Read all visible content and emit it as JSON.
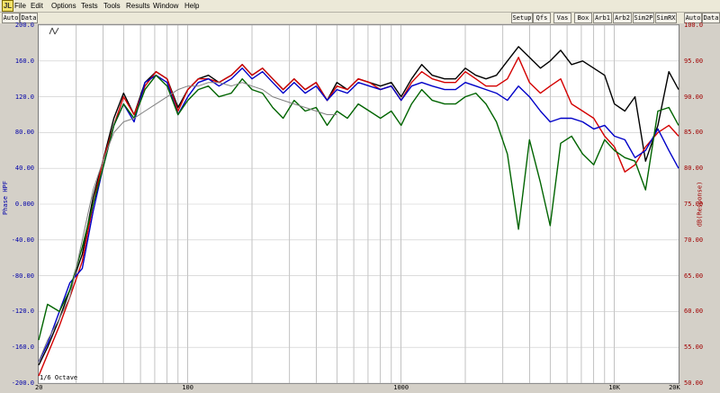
{
  "menu": {
    "app_icon": "JL",
    "items": [
      "File",
      "Edit",
      "Options",
      "Tests",
      "Tools",
      "Results",
      "Window",
      "Help"
    ]
  },
  "toolbar": {
    "left_buttons": [
      "Auto",
      "Data"
    ],
    "right_buttons": [
      "Setup",
      "Qfs",
      "Vas",
      "Box",
      "Arb1",
      "Arb2",
      "Sim2P",
      "SimRX"
    ],
    "far_right": [
      "Auto",
      "Data"
    ]
  },
  "annotation": {
    "smoothing": "1/6 Octave",
    "logo": "JL"
  },
  "colors": {
    "black": "#000000",
    "red": "#d40000",
    "blue": "#0000c8",
    "green": "#006400",
    "gray": "#808080",
    "left_axis": "#0000a8",
    "right_axis": "#a00000"
  },
  "chart_data": {
    "type": "line",
    "x_scale": "log",
    "xlim": [
      20,
      20000
    ],
    "x_tick_labels": [
      "20",
      "100",
      "1000",
      "10K",
      "20K"
    ],
    "x_ticks": [
      20,
      100,
      1000,
      10000,
      20000
    ],
    "left_axis": {
      "label": "Phase HPF",
      "ylim": [
        -200,
        200
      ],
      "ticks": [
        "200.0",
        "160.0",
        "120.0",
        "80.00",
        "40.00",
        "0.000",
        "-40.00",
        "-80.00",
        "-120.0",
        "-160.0",
        "-200.0"
      ]
    },
    "right_axis": {
      "label": "dB(Response)",
      "ylim": [
        50,
        100
      ],
      "ticks": [
        "100.0",
        "95.00",
        "90.00",
        "85.00",
        "80.00",
        "75.00",
        "70.00",
        "65.00",
        "60.00",
        "55.00",
        "50.00"
      ]
    },
    "grid": true,
    "series": [
      {
        "color": "black",
        "x": [
          20,
          22,
          25,
          28,
          32,
          36,
          40,
          45,
          50,
          56,
          63,
          71,
          80,
          90,
          100,
          112,
          125,
          140,
          160,
          180,
          200,
          224,
          250,
          280,
          315,
          355,
          400,
          450,
          500,
          560,
          630,
          710,
          800,
          900,
          1000,
          1120,
          1250,
          1400,
          1600,
          1800,
          2000,
          2240,
          2500,
          2800,
          3150,
          3550,
          4000,
          4500,
          5000,
          5600,
          6300,
          7100,
          8000,
          9000,
          10000,
          11200,
          12500,
          14000,
          16000,
          18000,
          20000
        ],
        "y": [
          52.5,
          55,
          59,
          63,
          68,
          76,
          81,
          87,
          90.5,
          87.5,
          92,
          93.5,
          92.5,
          88.5,
          91,
          92.5,
          93,
          92,
          93,
          94.5,
          93,
          94,
          92.5,
          91,
          92.5,
          91,
          92,
          89.5,
          92,
          91,
          92.5,
          92,
          91.5,
          92,
          90,
          92.5,
          94.5,
          93,
          92.5,
          92.5,
          94,
          93,
          92.5,
          93,
          95,
          97,
          95.5,
          94,
          95,
          96.5,
          94.5,
          95,
          94,
          93,
          89,
          88,
          90,
          81,
          86,
          93.5,
          91
        ]
      },
      {
        "color": "red",
        "x": [
          20,
          22,
          25,
          28,
          32,
          36,
          40,
          45,
          50,
          56,
          63,
          71,
          80,
          90,
          100,
          112,
          125,
          140,
          160,
          180,
          200,
          224,
          250,
          280,
          315,
          355,
          400,
          450,
          500,
          560,
          630,
          710,
          800,
          900,
          1000,
          1120,
          1250,
          1400,
          1600,
          1800,
          2000,
          2240,
          2500,
          2800,
          3150,
          3550,
          4000,
          4500,
          5000,
          5600,
          6300,
          7100,
          8000,
          9000,
          10000,
          11200,
          12500,
          14000,
          16000,
          18000,
          20000
        ],
        "y": [
          51,
          54,
          58,
          62,
          67,
          75,
          81,
          86,
          90,
          87.5,
          91.5,
          93.5,
          92.5,
          88,
          91,
          92.5,
          92.5,
          92,
          93,
          94.5,
          93,
          94,
          92.5,
          91,
          92.5,
          91,
          92,
          89.5,
          91.5,
          91,
          92.5,
          92,
          91,
          91.5,
          89.5,
          92,
          93.5,
          92.5,
          92,
          92,
          93.5,
          92.5,
          91.5,
          91.5,
          92.5,
          95.5,
          92,
          90.5,
          91.5,
          92.5,
          89,
          88,
          87,
          84.5,
          83,
          79.5,
          80.5,
          83,
          85,
          86,
          84.5
        ]
      },
      {
        "color": "blue",
        "x": [
          20,
          22,
          25,
          28,
          32,
          36,
          40,
          45,
          50,
          56,
          63,
          71,
          80,
          90,
          100,
          112,
          125,
          140,
          160,
          180,
          200,
          224,
          250,
          280,
          315,
          355,
          400,
          450,
          500,
          560,
          630,
          710,
          800,
          900,
          1000,
          1120,
          1250,
          1400,
          1600,
          1800,
          2000,
          2240,
          2500,
          2800,
          3150,
          3550,
          4000,
          4500,
          5000,
          5600,
          6300,
          7100,
          8000,
          9000,
          10000,
          11200,
          12500,
          14000,
          16000,
          18000,
          20000
        ],
        "y": [
          53,
          55.5,
          60,
          64,
          66,
          74,
          80,
          86,
          89,
          86.5,
          92,
          93,
          92,
          87.5,
          90,
          92,
          92.5,
          91.5,
          92.5,
          94,
          92.5,
          93.5,
          92,
          90.5,
          92,
          90.5,
          91.5,
          89.5,
          91,
          90.5,
          92,
          91.5,
          91,
          91.5,
          89.5,
          91.5,
          92,
          91.5,
          91,
          91,
          92,
          91.5,
          91,
          90.5,
          89.5,
          91.5,
          90,
          88,
          86.5,
          87,
          87,
          86.5,
          85.5,
          86,
          84.5,
          84,
          81.5,
          82.5,
          85.5,
          82.5,
          80
        ]
      },
      {
        "color": "green",
        "x": [
          20,
          22,
          25,
          28,
          32,
          36,
          40,
          45,
          50,
          56,
          63,
          71,
          80,
          90,
          100,
          112,
          125,
          140,
          160,
          180,
          200,
          224,
          250,
          280,
          315,
          355,
          400,
          450,
          500,
          560,
          630,
          710,
          800,
          900,
          1000,
          1120,
          1250,
          1400,
          1600,
          1800,
          2000,
          2240,
          2500,
          2800,
          3150,
          3550,
          4000,
          4500,
          5000,
          5600,
          6300,
          7100,
          8000,
          9000,
          10000,
          11200,
          12500,
          14000,
          16000,
          18000,
          20000
        ],
        "y": [
          56,
          61,
          60,
          63,
          69,
          75,
          80,
          86,
          89,
          87,
          91,
          93,
          91.5,
          87.5,
          89.5,
          91,
          91.5,
          90,
          90.5,
          92.5,
          91,
          90.5,
          88.5,
          87,
          89.5,
          88,
          88.5,
          86,
          88,
          87,
          89,
          88,
          87,
          88,
          86,
          89,
          91,
          89.5,
          89,
          89,
          90,
          90.5,
          89,
          86.5,
          82,
          71.5,
          84,
          78,
          72,
          83.5,
          84.5,
          82,
          80.5,
          84,
          82.5,
          81.5,
          81,
          77,
          88,
          88.5,
          86
        ]
      },
      {
        "color": "gray",
        "x": [
          20,
          22,
          25,
          28,
          32,
          36,
          40,
          45,
          50,
          56,
          63,
          71,
          80,
          90,
          100,
          112,
          125,
          140,
          160,
          180,
          200,
          224,
          250,
          280,
          315,
          355,
          400,
          450,
          500
        ],
        "y": [
          53,
          56,
          59,
          62,
          70,
          77,
          81,
          85,
          86.5,
          87,
          88,
          89,
          90,
          91,
          91.5,
          91.5,
          92,
          92,
          91.5,
          92,
          91.5,
          91,
          90,
          89.5,
          89,
          88.5,
          88,
          87.5,
          87.5
        ]
      }
    ]
  }
}
